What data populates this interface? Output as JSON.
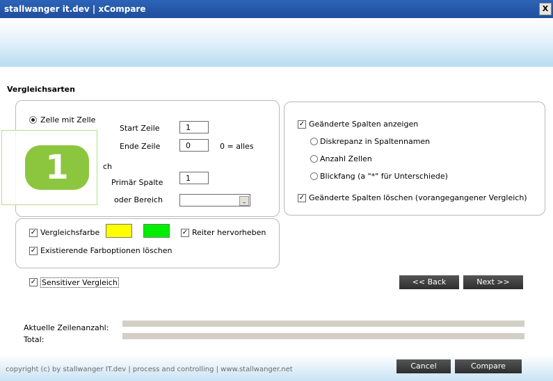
{
  "window": {
    "title": "stallwanger it.dev | xCompare",
    "close_symbol": "X"
  },
  "section": {
    "title": "Vergleichsarten"
  },
  "left_panel": {
    "radio_cell": "Zelle mit Zelle",
    "radio_range_partial": "ch",
    "start_row_label": "Start Zeile",
    "start_row_value": "1",
    "end_row_label": "Ende Zeile",
    "end_row_value": "0",
    "end_row_hint": "0 = alles",
    "primary_col_label": "Primär Spalte",
    "primary_col_value": "1",
    "range_label": "oder Bereich",
    "range_value": "",
    "dropdown_glyph": "_"
  },
  "color_panel": {
    "compare_color_label": "Vergleichsfarbe",
    "highlight_tab_label": "Reiter hervorheben",
    "delete_color_options_label": "Existierende Farboptionen löschen",
    "swatch_colors": [
      "#ffff00",
      "#00ee00"
    ]
  },
  "sensitive_label": "Sensitiver Vergleich",
  "right_panel": {
    "show_changed_cols": "Geänderte Spalten anzeigen",
    "option_discrepancy": "Diskrepanz in Spaltennamen",
    "option_cell_count": "Anzahl Zellen",
    "option_eyecatcher": "Blickfang (a \"*\" für Unterschiede)",
    "delete_changed_cols": "Geänderte Spalten löschen (vorangegangener Vergleich)"
  },
  "badge": {
    "number": "1",
    "color": "#8cc63e"
  },
  "nav": {
    "back": "<< Back",
    "next": "Next >>"
  },
  "progress": {
    "current_rows_label": "Aktuelle Zeilenanzahl:",
    "total_label": "Total:"
  },
  "footer": {
    "copyright": "copyright (c) by stallwanger IT.dev | process and controlling   | www.stallwanger.net",
    "cancel": "Cancel",
    "compare": "Compare"
  }
}
